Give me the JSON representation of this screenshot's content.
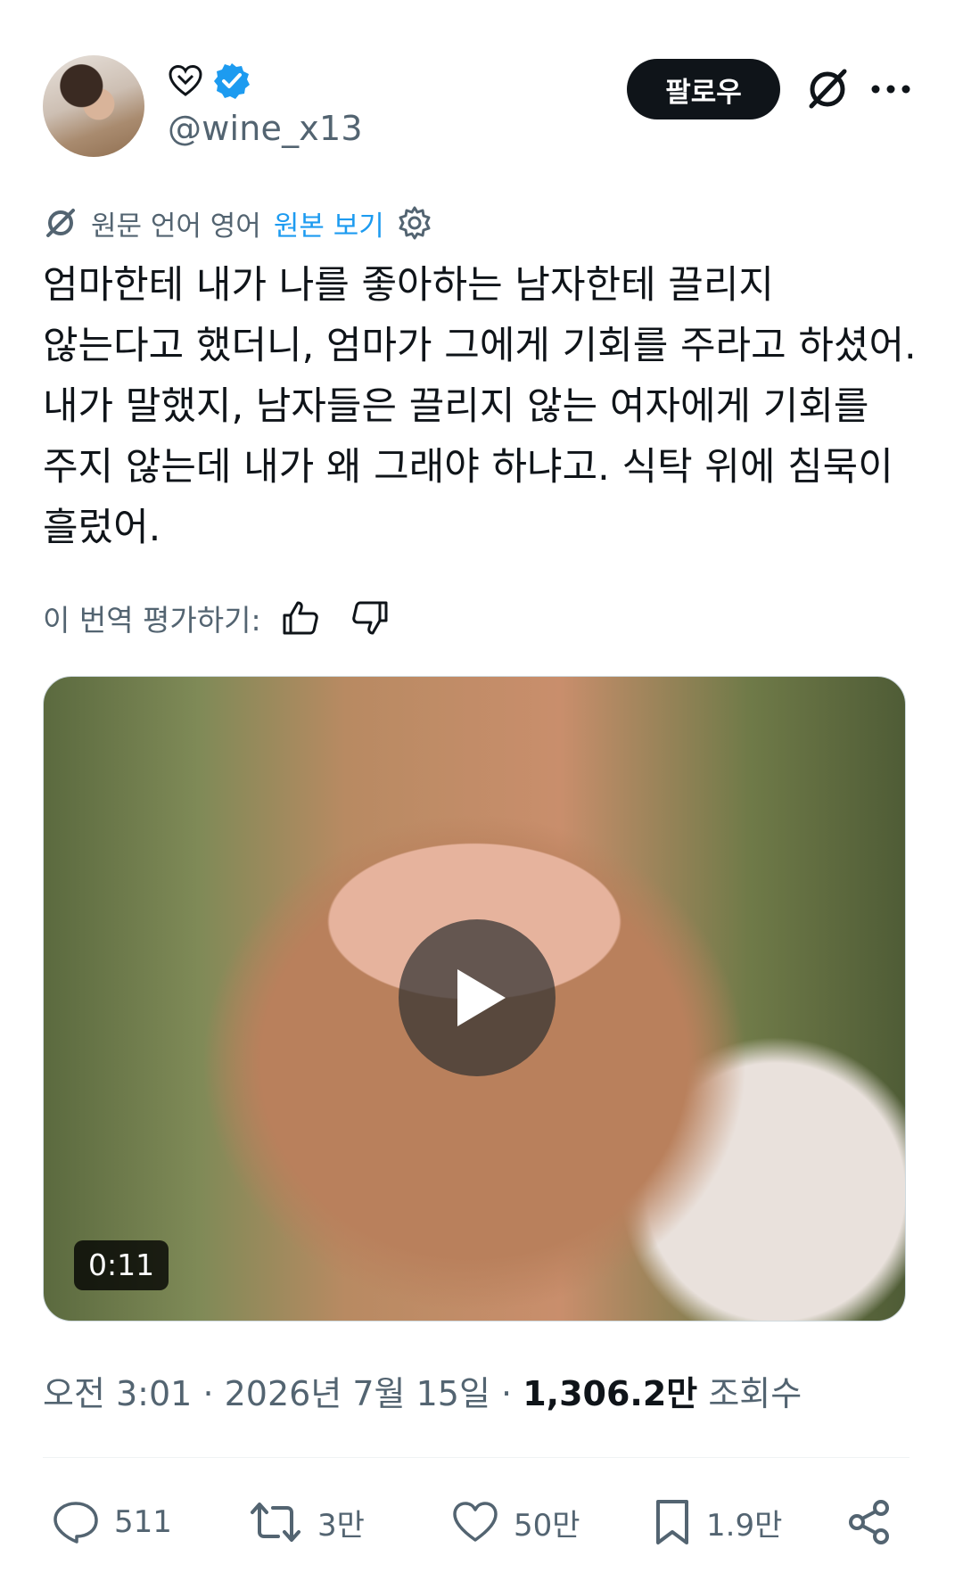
{
  "user": {
    "handle": "@wine_x13",
    "name_icon": "heart-outline-icon",
    "verified_icon": "verified-badge-icon",
    "follow_label": "팔로우"
  },
  "translation": {
    "source_label": "원문 언어 영어",
    "view_original_label": "원본 보기",
    "rate_label": "이 번역 평가하기:"
  },
  "post": {
    "text": "엄마한테 내가 나를 좋아하는 남자한테 끌리지 않는다고 했더니, 엄마가 그에게 기회를 주라고 하셨어. 내가 말했지, 남자들은 끌리지 않는 여자에게 기회를 주지 않는데 내가 왜 그래야 하냐고. 식탁 위에 침묵이 흘렀어.",
    "video_duration": "0:11",
    "time": "오전 3:01",
    "separator": "·",
    "date": "2026년 7월 15일",
    "views_count": "1,306.2만",
    "views_label": "조회수"
  },
  "actions": {
    "replies": "511",
    "reposts": "3만",
    "likes": "50만",
    "bookmarks": "1.9만"
  },
  "colors": {
    "text_primary": "#0f1419",
    "text_secondary": "#536471",
    "link": "#1d9bf0",
    "verified": "#1d9bf0"
  }
}
